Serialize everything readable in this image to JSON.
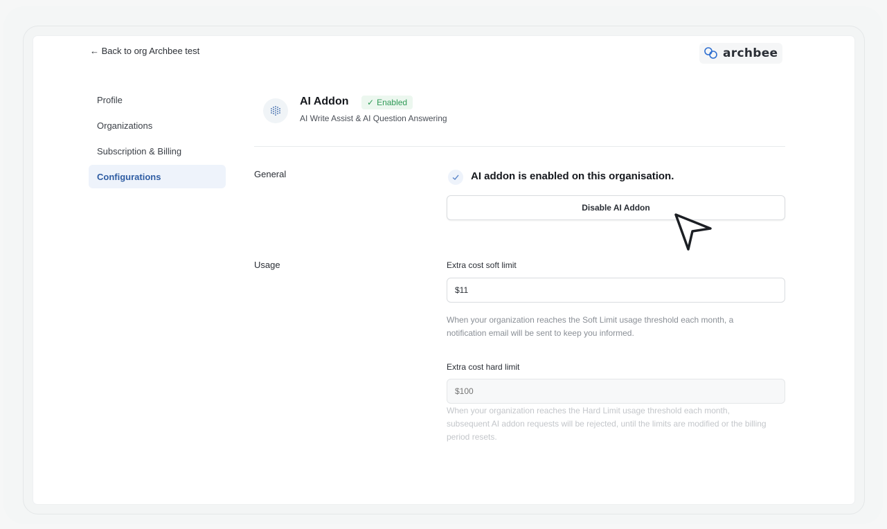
{
  "back_link": "← Back to org Archbee test",
  "logo": {
    "text": "archbee",
    "icon": "archbee-logo-icon"
  },
  "nav": {
    "items": [
      {
        "label": "Profile"
      },
      {
        "label": "Organizations"
      },
      {
        "label": "Subscription & Billing"
      },
      {
        "label": "Configurations",
        "active": true
      }
    ]
  },
  "addon": {
    "icon": "ai-dots-icon",
    "title": "AI Addon",
    "badge": "Enabled",
    "subtitle": "AI Write Assist & AI Question Answering"
  },
  "general": {
    "label": "General",
    "status_text": "AI addon is enabled on this organisation.",
    "disable_button": "Disable AI Addon"
  },
  "usage": {
    "label": "Usage",
    "soft_limit": {
      "label": "Extra cost soft limit",
      "value": "$11",
      "help": "When your organization reaches the Soft Limit usage threshold each month, a notification email will be sent to keep you informed."
    },
    "hard_limit": {
      "label": "Extra cost hard limit",
      "placeholder": "$100",
      "help": "When your organization reaches the Hard Limit usage threshold each month, subsequent AI addon requests will be rejected, until the limits are modified or the billing period resets."
    }
  },
  "colors": {
    "accent": "#2f5da3",
    "badge_green": "#2e9a56",
    "badge_bg": "#ecf7ef",
    "active_nav_bg": "#eef3fb"
  }
}
